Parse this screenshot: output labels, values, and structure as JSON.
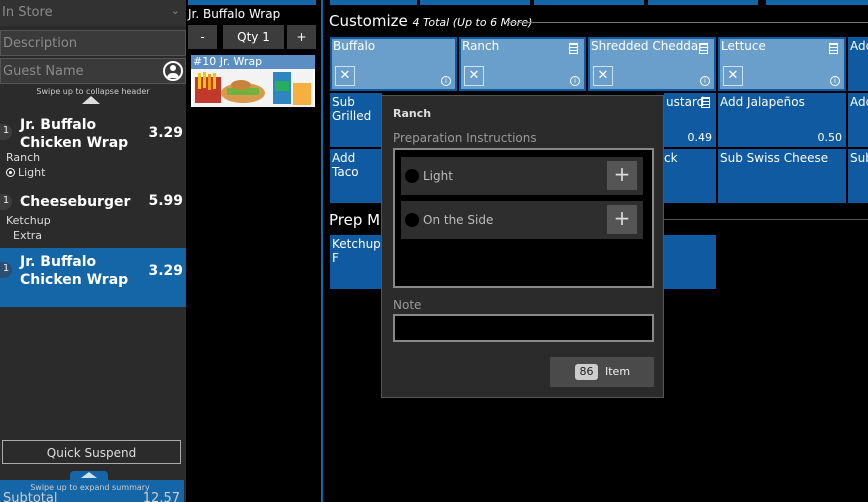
{
  "left_panel": {
    "store_select": "In Store",
    "description_placeholder": "Description",
    "guest_placeholder": "Guest Name",
    "collapse_hint": "Swipe up to collapse header",
    "lines": [
      {
        "qty": "1",
        "name": "Jr. Buffalo Chicken Wrap",
        "price": "3.29",
        "mods": [
          "Ranch",
          "Light"
        ]
      },
      {
        "qty": "1",
        "name": "Cheeseburger",
        "price": "5.99",
        "mods": [
          "Ketchup",
          "Extra"
        ]
      },
      {
        "qty": "1",
        "name": "Jr. Buffalo Chicken Wrap",
        "price": "3.29",
        "mods": []
      }
    ],
    "quick_suspend": "Quick Suspend",
    "expand_hint": "Swipe up to expand summary",
    "subtotal_label": "Subtotal",
    "subtotal_value": "12.57"
  },
  "middle": {
    "title": "Jr. Buffalo Wrap",
    "minus": "-",
    "qty": "Qty 1",
    "plus": "+",
    "combo_label": "#10 Jr. Wrap"
  },
  "customize": {
    "title": "Customize",
    "subtitle": "4 Total (Up to 6 More)",
    "tiles": [
      {
        "label": "Buffalo",
        "selected": true
      },
      {
        "label": "Ranch",
        "selected": true
      },
      {
        "label": "Shredded Cheddar",
        "selected": true
      },
      {
        "label": "Lettuce",
        "selected": true
      },
      {
        "label": "Add",
        "selected": false
      },
      {
        "label": "Sub Grilled",
        "selected": false
      },
      {
        "label": "ustard",
        "selected": false
      },
      {
        "label": "Add Jalapeños",
        "selected": false,
        "price": "0.50"
      },
      {
        "label": "Add",
        "selected": false
      },
      {
        "label": "Add Taco",
        "selected": false
      },
      {
        "label": "ck",
        "selected": false
      },
      {
        "label": "Sub Swiss Cheese",
        "selected": false
      },
      {
        "label": "Sub",
        "selected": false
      }
    ],
    "mustard_price": "0.49",
    "prep_title": "Prep Mo",
    "prep_tile": "Ketchup F"
  },
  "dialog": {
    "title": "Ranch",
    "prep_label": "Preparation Instructions",
    "options": [
      "Light",
      "On the Side"
    ],
    "note_label": "Note",
    "badge": "86",
    "item_label": "Item"
  },
  "colors": {
    "accent": "#1466a6",
    "tile": "#0f5aa0",
    "tile_selected": "#6a9ecb"
  }
}
